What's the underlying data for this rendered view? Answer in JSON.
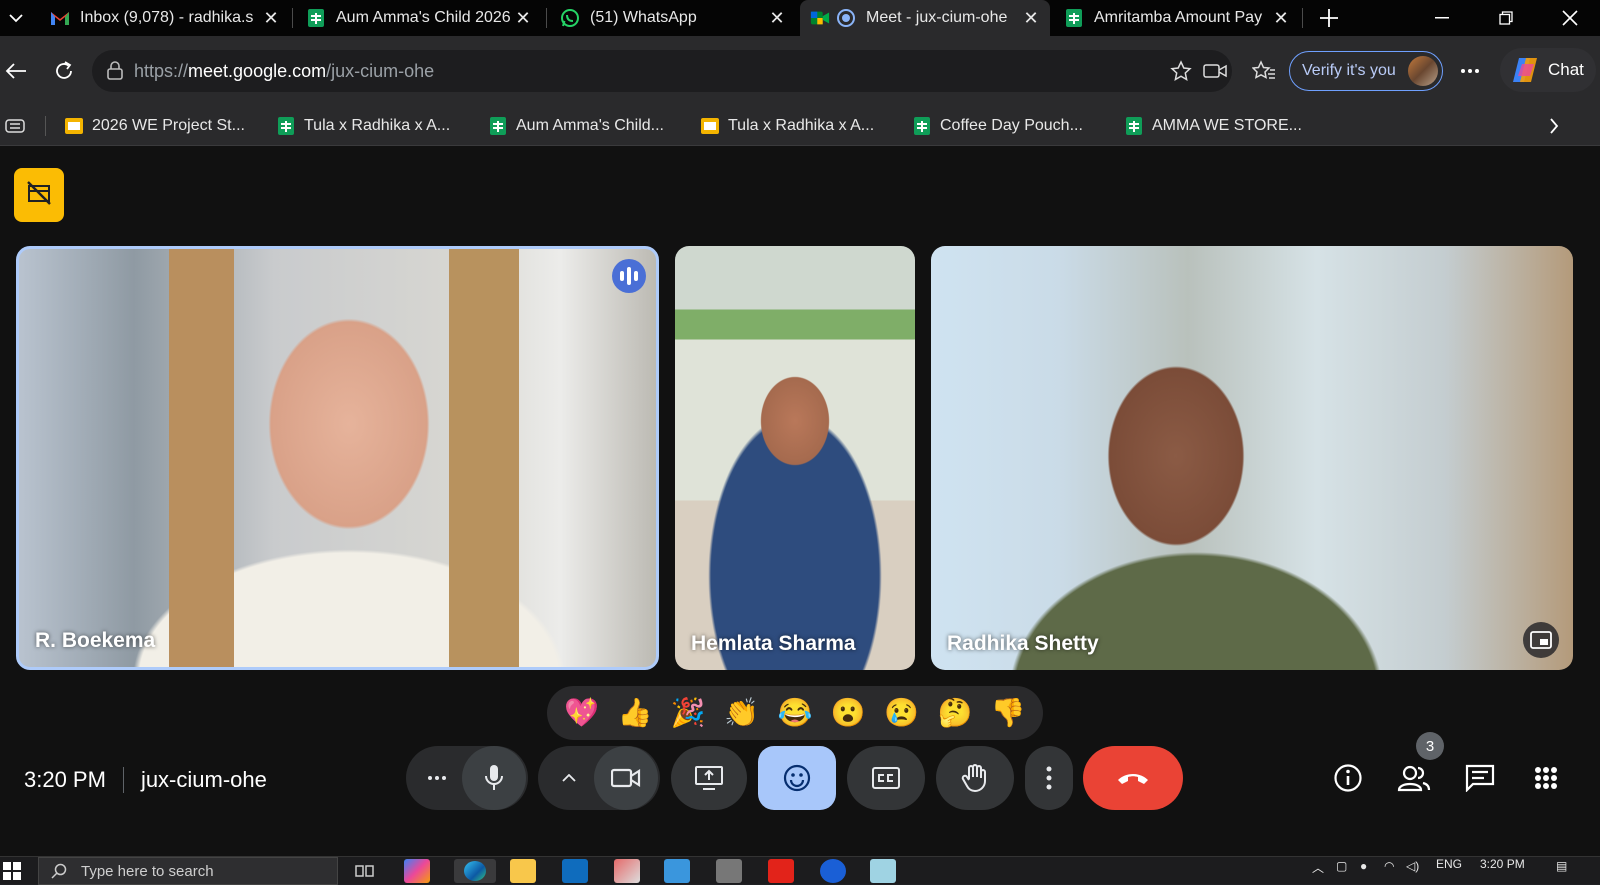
{
  "tabs": [
    {
      "title": "Inbox (9,078) - radhika.s",
      "icon": "gmail-icon"
    },
    {
      "title": "Aum Amma's Child 2026",
      "icon": "sheets-icon"
    },
    {
      "title": "(51) WhatsApp",
      "icon": "whatsapp-icon"
    },
    {
      "title": "Meet - jux-cium-ohe",
      "icon": "meet-icon",
      "active": true
    },
    {
      "title": "Amritamba Amount Pay",
      "icon": "sheets-icon"
    }
  ],
  "addressbar": {
    "scheme": "https://",
    "host": "meet.google.com",
    "path": "/jux-cium-ohe",
    "verify_label": "Verify it's you",
    "chat_label": "Chat"
  },
  "bookmarks": [
    {
      "label": "2026 WE Project St...",
      "icon": "slides-icon"
    },
    {
      "label": "Tula x Radhika x A...",
      "icon": "sheets-icon"
    },
    {
      "label": "Aum Amma's Child...",
      "icon": "sheets-icon"
    },
    {
      "label": "Tula x Radhika x A...",
      "icon": "slides-icon"
    },
    {
      "label": "Coffee Day Pouch...",
      "icon": "sheets-icon"
    },
    {
      "label": "AMMA WE STORE...",
      "icon": "sheets-icon"
    }
  ],
  "participants": [
    {
      "name": "R. Boekema",
      "speaking": true
    },
    {
      "name": "Hemlata Sharma"
    },
    {
      "name": "Radhika Shetty"
    }
  ],
  "reactions": [
    "💖",
    "👍",
    "🎉",
    "👏",
    "😂",
    "😮",
    "😢",
    "🤔",
    "👎"
  ],
  "meeting": {
    "time": "3:20 PM",
    "code": "jux-cium-ohe",
    "participant_count": "3"
  },
  "taskbar": {
    "search_placeholder": "Type here to search",
    "lang": "ENG",
    "time": "3:20 PM"
  },
  "colors": {
    "accent": "#a8c7fa",
    "end_call": "#ea4335",
    "notice": "#fbbc04"
  }
}
